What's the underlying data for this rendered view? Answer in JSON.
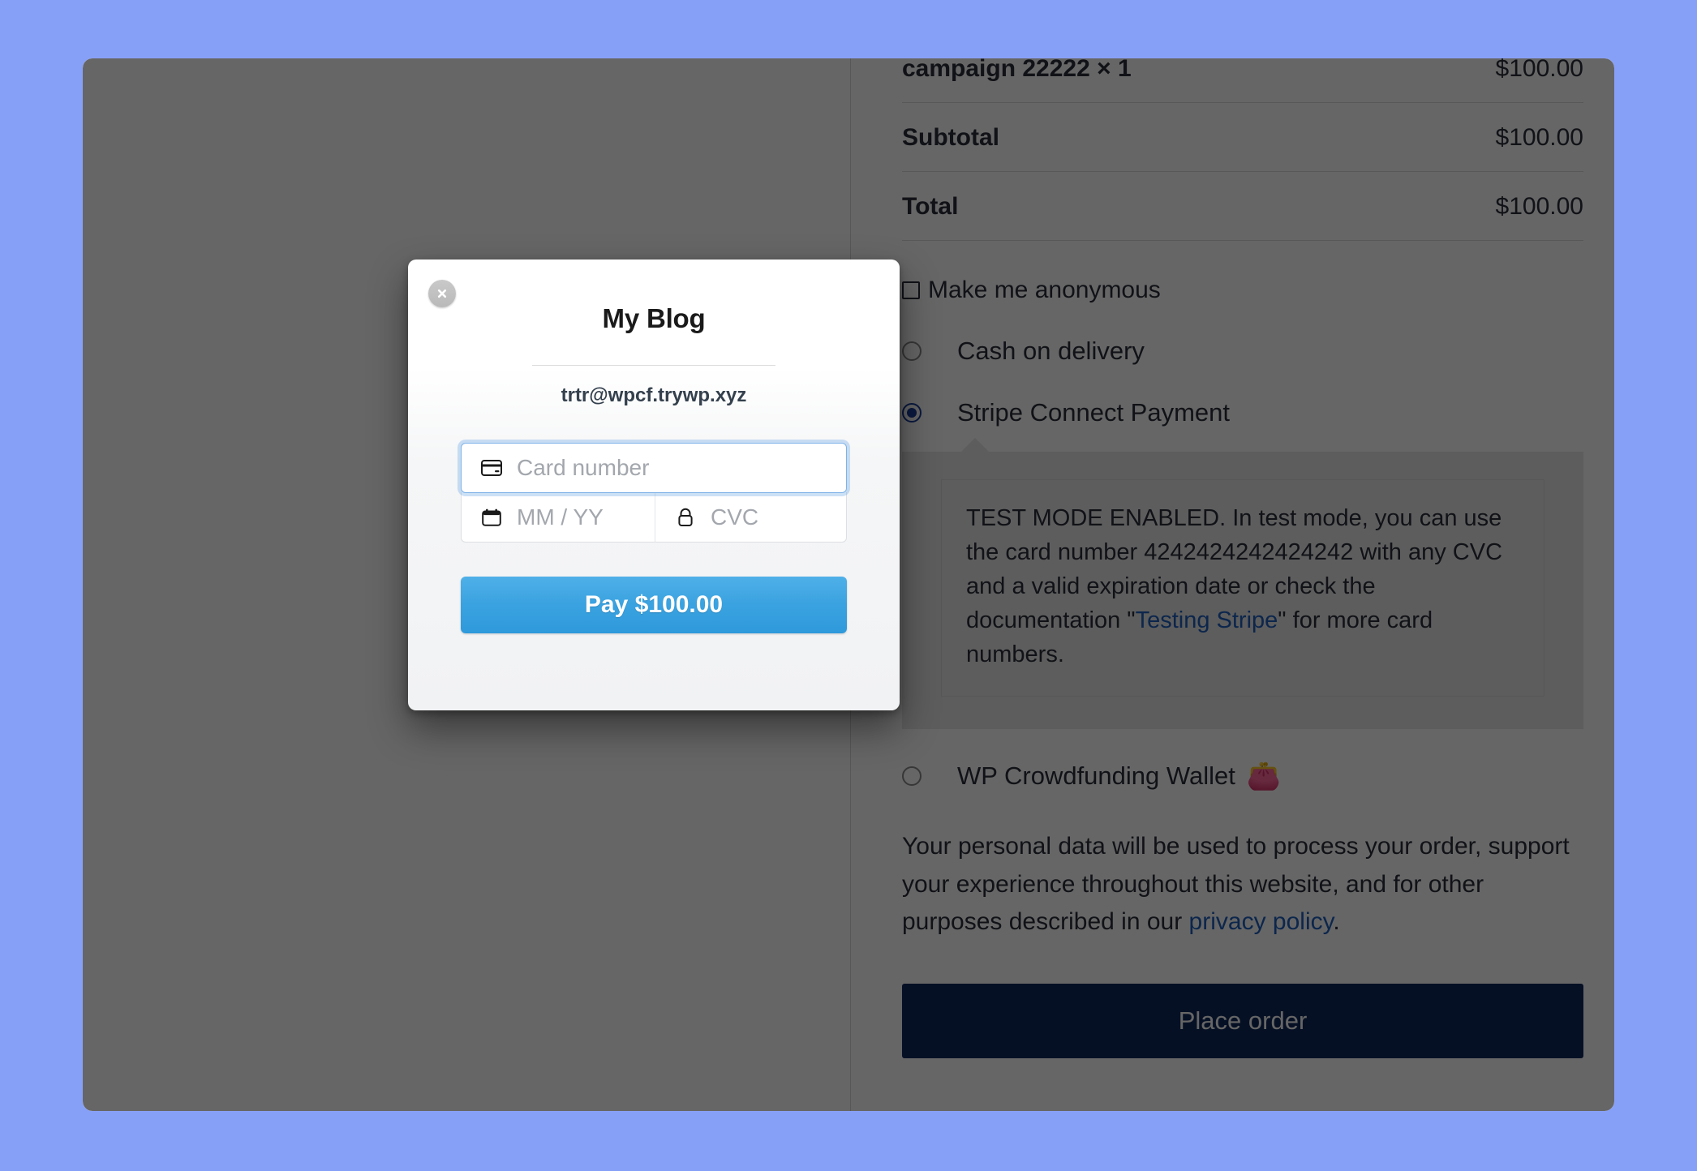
{
  "colors": {
    "page_background": "#87a0f7",
    "overlay": "rgba(0,0,0,0.60)",
    "place_order_bg": "#0f2a5c",
    "pay_button_blue": "#3aa2e0",
    "link_blue": "#1f5fbf",
    "radio_selected": "#1a3f9e"
  },
  "order_review": {
    "rows": [
      {
        "label": "campaign 22222 × 1",
        "amount": "$100.00"
      },
      {
        "label": "Subtotal",
        "amount": "$100.00"
      },
      {
        "label": "Total",
        "amount": "$100.00"
      }
    ]
  },
  "anonymous": {
    "label": "Make me anonymous",
    "checked": false
  },
  "payment_methods": [
    {
      "label": "Cash on delivery",
      "selected": false
    },
    {
      "label": "Stripe Connect Payment",
      "selected": true
    },
    {
      "label": "WP Crowdfunding Wallet",
      "selected": false,
      "emoji": "👛"
    }
  ],
  "stripe_notice": {
    "text_before_link": "TEST MODE ENABLED. In test mode, you can use the card number 4242424242424242 with any CVC and a valid expiration date or check the documentation \"",
    "link_label": "Testing Stripe",
    "text_after_link": "\" for more card numbers.",
    "card_number": "4242424242424242"
  },
  "privacy": {
    "text_before_link": "Your personal data will be used to process your order, support your experience throughout this website, and for other purposes described in our ",
    "link_label": "privacy policy",
    "text_after_link": "."
  },
  "place_order": {
    "label": "Place order"
  },
  "stripe_modal": {
    "close_icon": "close-icon",
    "merchant_name": "My Blog",
    "email": "trtr@wpcf.trywp.xyz",
    "fields": {
      "card_number_placeholder": "Card number",
      "card_number_value": "",
      "expiry_placeholder": "MM / YY",
      "expiry_value": "",
      "cvc_placeholder": "CVC",
      "cvc_value": ""
    },
    "pay_button_label": "Pay $100.00"
  }
}
